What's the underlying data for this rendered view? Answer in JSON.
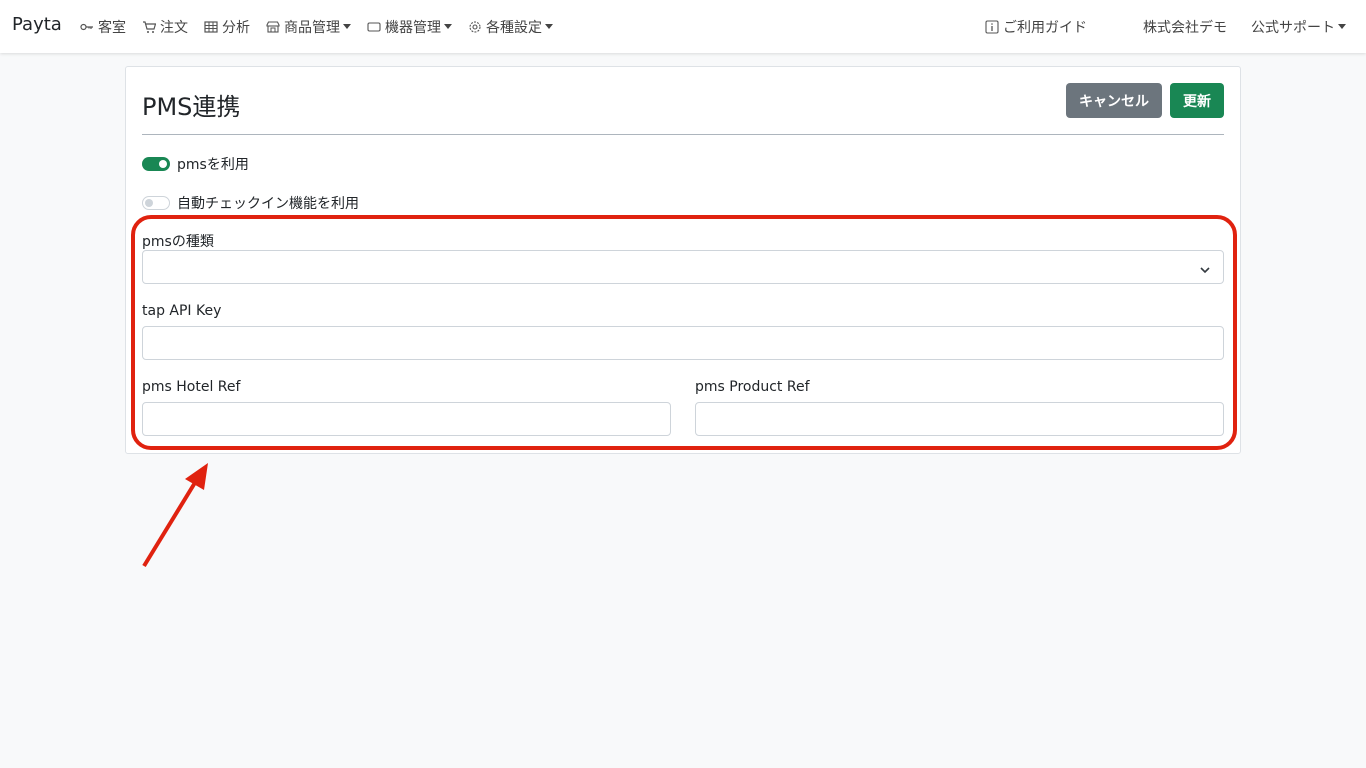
{
  "navbar": {
    "brand": "Payta",
    "items": [
      {
        "label": "客室",
        "icon": "key-icon",
        "dropdown": false
      },
      {
        "label": "注文",
        "icon": "cart-icon",
        "dropdown": false
      },
      {
        "label": "分析",
        "icon": "table-icon",
        "dropdown": false
      },
      {
        "label": "商品管理",
        "icon": "shop-icon",
        "dropdown": true
      },
      {
        "label": "機器管理",
        "icon": "tablet-icon",
        "dropdown": true
      },
      {
        "label": "各種設定",
        "icon": "gear-icon",
        "dropdown": true
      }
    ],
    "guide": "ご利用ガイド",
    "company": "株式会社デモ",
    "support": "公式サポート"
  },
  "page": {
    "title": "PMS連携",
    "cancel_label": "キャンセル",
    "update_label": "更新"
  },
  "form": {
    "use_pms": {
      "label": "pmsを利用",
      "checked": true
    },
    "auto_checkin": {
      "label": "自動チェックイン機能を利用",
      "checked": false
    },
    "pms_type": {
      "label": "pmsの種類",
      "value": ""
    },
    "tap_api_key": {
      "label": "tap API Key",
      "value": ""
    },
    "pms_hotel_ref": {
      "label": "pms Hotel Ref",
      "value": ""
    },
    "pms_product_ref": {
      "label": "pms Product Ref",
      "value": ""
    }
  },
  "colors": {
    "primary_green": "#198754",
    "secondary_gray": "#6c757d",
    "annotation_red": "#e0220f"
  }
}
